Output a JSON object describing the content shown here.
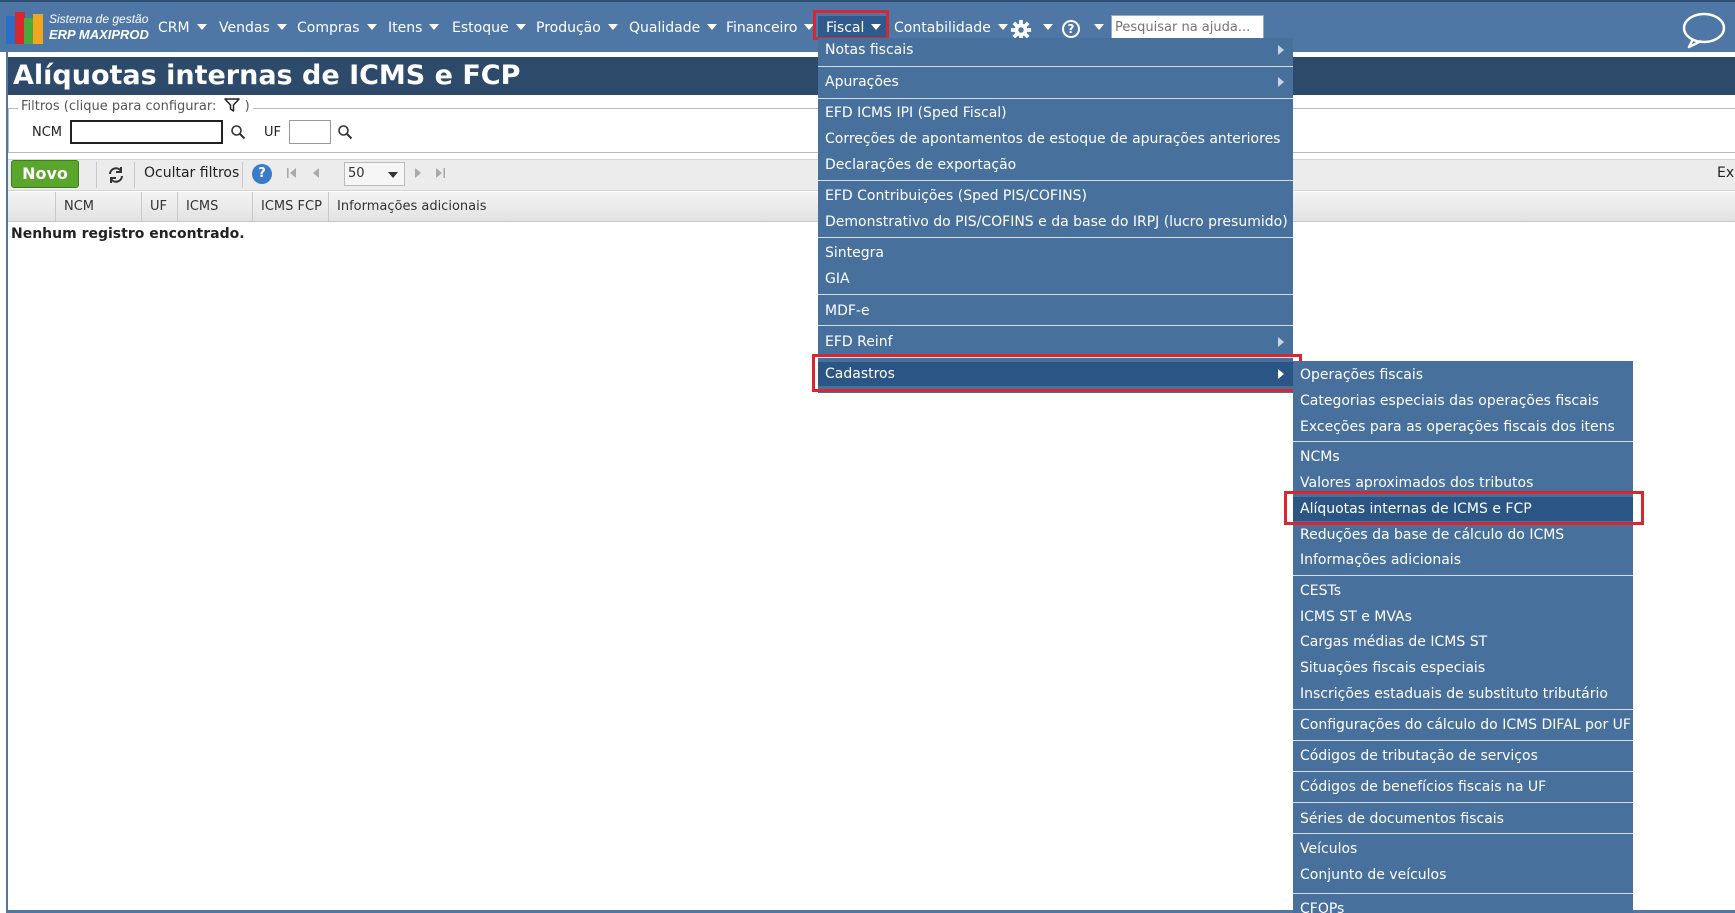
{
  "app": {
    "logo_line1": "Sistema de gestão",
    "logo_line2": "ERP MAXIPROD",
    "logo_colors": [
      "#2a6fc7",
      "#d8272f",
      "#4aa83c",
      "#f2a51f"
    ]
  },
  "nav": {
    "items": [
      {
        "label": "CRM"
      },
      {
        "label": "Vendas"
      },
      {
        "label": "Compras"
      },
      {
        "label": "Itens"
      },
      {
        "label": "Estoque"
      },
      {
        "label": "Produção"
      },
      {
        "label": "Qualidade"
      },
      {
        "label": "Financeiro"
      },
      {
        "label": "Fiscal"
      },
      {
        "label": "Contabilidade"
      }
    ],
    "settings_icon": "gear-icon",
    "help_icon": "question-icon",
    "search_placeholder": "Pesquisar na ajuda...",
    "chat_icon": "chat-bubble-icon"
  },
  "page": {
    "title": "Alíquotas internas de ICMS e FCP"
  },
  "filters": {
    "legend": "Filtros (clique para configurar:",
    "legend_close": ")",
    "ncm_label": "NCM",
    "ncm_value": "",
    "uf_label": "UF",
    "uf_value": ""
  },
  "toolbar": {
    "novo_label": "Novo",
    "ocultar_label": "Ocultar filtros",
    "help_label": "?",
    "page_size": "50",
    "export_label": "Ex"
  },
  "table": {
    "columns": [
      "NCM",
      "UF",
      "ICMS",
      "ICMS FCP",
      "Informações adicionais"
    ],
    "empty_message": "Nenhum registro encontrado."
  },
  "fiscal_menu": {
    "items": [
      {
        "label": "Notas fiscais"
      },
      {
        "label": "Apurações"
      },
      {
        "label": "EFD ICMS IPI (Sped Fiscal)"
      },
      {
        "label": "Correções de apontamentos de estoque de apurações anteriores"
      },
      {
        "label": "Declarações de exportação"
      },
      {
        "label": "EFD Contribuições (Sped PIS/COFINS)"
      },
      {
        "label": "Demonstrativo do PIS/COFINS e da base do IRPJ (lucro presumido)"
      },
      {
        "label": "Sintegra"
      },
      {
        "label": "GIA"
      },
      {
        "label": "MDF-e"
      },
      {
        "label": "EFD Reinf"
      },
      {
        "label": "Cadastros"
      }
    ]
  },
  "cadastros_menu": {
    "items": [
      {
        "label": "Operações fiscais"
      },
      {
        "label": "Categorias especiais das operações fiscais"
      },
      {
        "label": "Exceções para as operações fiscais dos itens"
      },
      {
        "label": "NCMs"
      },
      {
        "label": "Valores aproximados dos tributos"
      },
      {
        "label": "Alíquotas internas de ICMS e FCP"
      },
      {
        "label": "Reduções da base de cálculo do ICMS"
      },
      {
        "label": "Informações adicionais"
      },
      {
        "label": "CESTs"
      },
      {
        "label": "ICMS ST e MVAs"
      },
      {
        "label": "Cargas médias de ICMS ST"
      },
      {
        "label": "Situações fiscais especiais"
      },
      {
        "label": "Inscrições estaduais de substituto tributário"
      },
      {
        "label": "Configurações do cálculo do ICMS DIFAL por UF"
      },
      {
        "label": "Códigos de tributação de serviços"
      },
      {
        "label": "Códigos de benefícios fiscais na UF"
      },
      {
        "label": "Séries de documentos fiscais"
      },
      {
        "label": "Veículos"
      },
      {
        "label": "Conjunto de veículos"
      },
      {
        "label": "CFOPs"
      }
    ]
  },
  "colors": {
    "nav_bg": "#4f77a6",
    "title_bg": "#2d4a6a",
    "menu_bg": "#48709d",
    "highlight": "#d8272f",
    "novo_green": "#5aa52c"
  }
}
